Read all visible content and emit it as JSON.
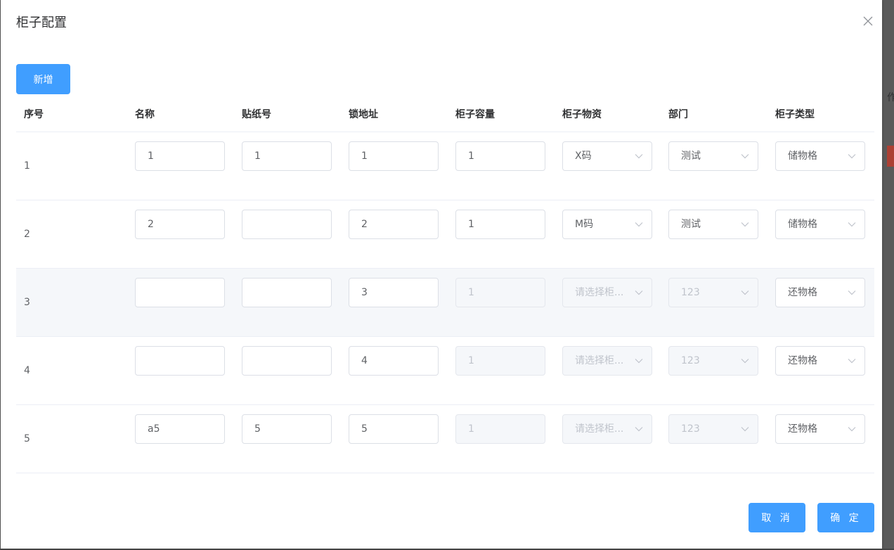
{
  "dialog": {
    "title": "柜子配置",
    "add_label": "新增",
    "cancel_label": "取 消",
    "confirm_label": "确 定"
  },
  "table": {
    "headers": {
      "seq": "序号",
      "name": "名称",
      "sticker": "贴纸号",
      "lock": "锁地址",
      "capacity": "柜子容量",
      "material": "柜子物资",
      "dept": "部门",
      "type": "柜子类型"
    },
    "rows": [
      {
        "seq": "1",
        "name": "1",
        "sticker": "1",
        "lock": "1",
        "capacity": "1",
        "material": "X码",
        "dept": "测试",
        "type": "储物格",
        "disabled": false
      },
      {
        "seq": "2",
        "name": "2",
        "sticker": "",
        "lock": "2",
        "capacity": "1",
        "material": "M码",
        "dept": "测试",
        "type": "储物格",
        "disabled": false
      },
      {
        "seq": "3",
        "name": "",
        "sticker": "",
        "lock": "3",
        "capacity": "1",
        "material": "",
        "material_placeholder": "请选择柜...",
        "dept": "123",
        "type": "还物格",
        "disabled": true
      },
      {
        "seq": "4",
        "name": "",
        "sticker": "",
        "lock": "4",
        "capacity": "1",
        "material": "",
        "material_placeholder": "请选择柜...",
        "dept": "123",
        "type": "还物格",
        "disabled": true
      },
      {
        "seq": "5",
        "name": "a5",
        "sticker": "5",
        "lock": "5",
        "capacity": "1",
        "material": "",
        "material_placeholder": "请选择柜...",
        "dept": "123",
        "type": "还物格",
        "disabled": true
      }
    ]
  },
  "colors": {
    "primary": "#409eff",
    "row_hover": "#f5f7fa",
    "disabled_bg": "#f5f7fa"
  }
}
